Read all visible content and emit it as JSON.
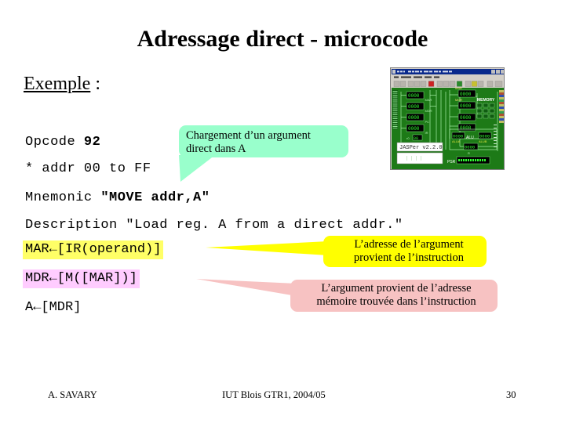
{
  "slide": {
    "title": "Adressage direct - microcode",
    "example_label": "Exemple",
    "example_colon": " :"
  },
  "code": {
    "opcode_label": "Opcode ",
    "opcode_value": "92",
    "addr_range": "* addr 00 to FF",
    "mnemonic_label": "Mnemonic ",
    "mnemonic_value": "\"MOVE addr,A\"",
    "description_label": "Description ",
    "description_value": "\"Load reg. A from a direct addr.\""
  },
  "microcode": {
    "steps": [
      {
        "text": "MAR←[IR(operand)]",
        "highlight": "#ffff66"
      },
      {
        "text": "MDR←[M([MAR])]",
        "highlight": "#ffccff"
      },
      {
        "text": "A←[MDR]",
        "highlight": "none"
      }
    ]
  },
  "callouts": {
    "green": {
      "line1": "Chargement d’un argument",
      "line2": "direct dans A",
      "color": "#99ffcc"
    },
    "yellow": {
      "line1": "L’adresse de l’argument",
      "line2": "provient de l’instruction",
      "color": "#ffff00"
    },
    "pink": {
      "line1": "L’argument provient de l’adresse",
      "line2": "mémoire trouvée dans l’instruction",
      "color": "#f7c2c2"
    }
  },
  "jasper": {
    "window_title": "JASPer - Just Another Simulated Processor",
    "menu": [
      "File",
      "Processor",
      "Memory",
      "Cover",
      "Help"
    ],
    "version_text": "JASPer v2.2.0",
    "labels": {
      "memory": "MEMORY",
      "alu": "ALU",
      "psr": "PSR",
      "mar": "MAR",
      "mdr": "MDR",
      "pc": "PC",
      "ir": "IR",
      "r0": "R0",
      "alua": "ALUA",
      "alub": "ALUB",
      "cpu": "CPU"
    },
    "register_value": "0000",
    "background_color": "#1e7a14"
  },
  "footer": {
    "author": "A. SAVARY",
    "center": "IUT Blois GTR1, 2004/05",
    "page": "30"
  }
}
